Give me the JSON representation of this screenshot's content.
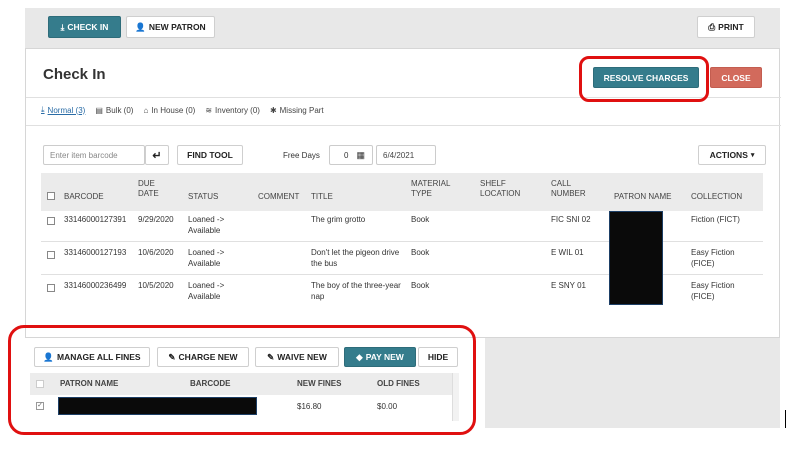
{
  "topbar": {
    "checkin_label": "CHECK IN",
    "newpatron_label": "NEW PATRON",
    "print_label": "PRINT"
  },
  "header": {
    "title": "Check In",
    "resolve_label": "RESOLVE CHARGES",
    "close_label": "CLOSE"
  },
  "tabs": [
    {
      "label": "Normal (3)",
      "icon": "download-icon"
    },
    {
      "label": "Bulk (0)",
      "icon": "stack-icon"
    },
    {
      "label": "In House (0)",
      "icon": "home-icon"
    },
    {
      "label": "Inventory (0)",
      "icon": "database-icon"
    },
    {
      "label": "Missing Part",
      "icon": "puzzle-icon"
    }
  ],
  "toolbar": {
    "barcode_placeholder": "Enter item barcode",
    "find_tool_label": "FIND TOOL",
    "free_days_label": "Free Days",
    "free_days_value": "0",
    "date_value": "6/4/2021",
    "actions_label": "ACTIONS"
  },
  "table": {
    "headers": [
      "BARCODE",
      "DUE DATE",
      "STATUS",
      "COMMENT",
      "TITLE",
      "MATERIAL TYPE",
      "SHELF LOCATION",
      "CALL NUMBER",
      "PATRON NAME",
      "COLLECTION"
    ],
    "rows": [
      {
        "barcode": "33146000127391",
        "due": "9/29/2020",
        "status": "Loaned -> Available",
        "comment": "",
        "title": "The grim grotto",
        "type": "Book",
        "shelf": "",
        "call": "FIC SNI 02",
        "collection": "Fiction (FICT)"
      },
      {
        "barcode": "33146000127193",
        "due": "10/6/2020",
        "status": "Loaned -> Available",
        "comment": "",
        "title": "Don't let the pigeon drive the bus",
        "type": "Book",
        "shelf": "",
        "call": "E WIL 01",
        "collection": "Easy Fiction (FICE)"
      },
      {
        "barcode": "33146000236499",
        "due": "10/5/2020",
        "status": "Loaned -> Available",
        "comment": "",
        "title": "The boy of the three-year nap",
        "type": "Book",
        "shelf": "",
        "call": "E SNY 01",
        "collection": "Easy Fiction (FICE)"
      }
    ]
  },
  "fines": {
    "manage_label": "MANAGE ALL FINES",
    "charge_label": "CHARGE NEW",
    "waive_label": "WAIVE NEW",
    "pay_label": "PAY NEW",
    "hide_label": "HIDE",
    "headers": [
      "PATRON NAME",
      "BARCODE",
      "NEW FINES",
      "OLD FINES"
    ],
    "row": {
      "new_fines": "$16.80",
      "old_fines": "$0.00"
    }
  },
  "colors": {
    "teal": "#357c8c",
    "close_red": "#d26a5c",
    "highlight_red": "#e01010"
  }
}
